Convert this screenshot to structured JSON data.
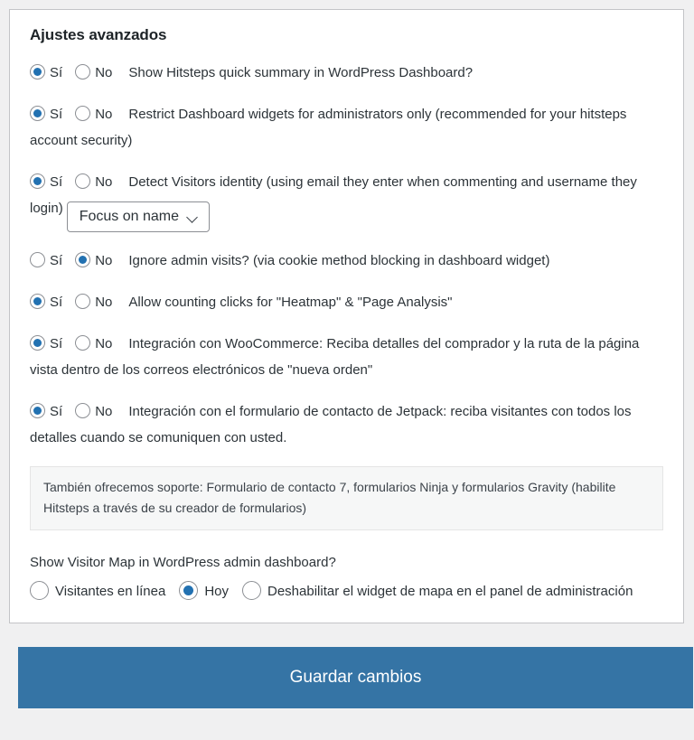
{
  "card": {
    "title": "Ajustes avanzados",
    "yes_label": "Sí",
    "no_label": "No",
    "options": [
      {
        "id": "quick-summary",
        "selected": "yes",
        "text": "Show Hitsteps quick summary in WordPress Dashboard?"
      },
      {
        "id": "restrict-widgets",
        "selected": "yes",
        "text": "Restrict Dashboard widgets for administrators only (recommended for your hitsteps account security)"
      },
      {
        "id": "detect-visitors-identity",
        "selected": "yes",
        "text": "Detect Visitors identity (using email they enter when commenting and username they login)",
        "select": {
          "name": "identity-focus-select",
          "value": "Focus on name",
          "icon": "chevron-down-icon"
        }
      },
      {
        "id": "ignore-admin-visits",
        "selected": "no",
        "text": "Ignore admin visits? (via cookie method blocking in dashboard widget)"
      },
      {
        "id": "allow-counting-clicks",
        "selected": "yes",
        "text": "Allow counting clicks for \"Heatmap\" & \"Page Analysis\""
      },
      {
        "id": "woocommerce-integration",
        "selected": "yes",
        "text": "Integración con WooCommerce: Reciba detalles del comprador y la ruta de la página vista dentro de los correos electrónicos de \"nueva orden\""
      },
      {
        "id": "jetpack-integration",
        "selected": "yes",
        "text": "Integración con el formulario de contacto de Jetpack: reciba visitantes con todos los detalles cuando se comuniquen con usted."
      }
    ],
    "note": "También ofrecemos soporte: Formulario de contacto 7, formularios Ninja y formularios Gravity (habilite Hitsteps a través de su creador de formularios)",
    "map_section": {
      "question": "Show Visitor Map in WordPress admin dashboard?",
      "choices": [
        {
          "id": "online-visitors",
          "label": "Visitantes en línea",
          "selected": false
        },
        {
          "id": "today",
          "label": "Hoy",
          "selected": true
        },
        {
          "id": "disable-map-widget",
          "label": "Deshabilitar el widget de mapa en el panel de administración",
          "selected": false
        }
      ]
    }
  },
  "submit": {
    "label": "Guardar cambios"
  },
  "colors": {
    "accent": "#2271b1",
    "button": "#3574a5",
    "page_background": "#f0f0f1",
    "card_background": "#ffffff",
    "card_border": "#c3c4c7",
    "note_background": "#f6f7f7",
    "text": "#2c3338"
  }
}
